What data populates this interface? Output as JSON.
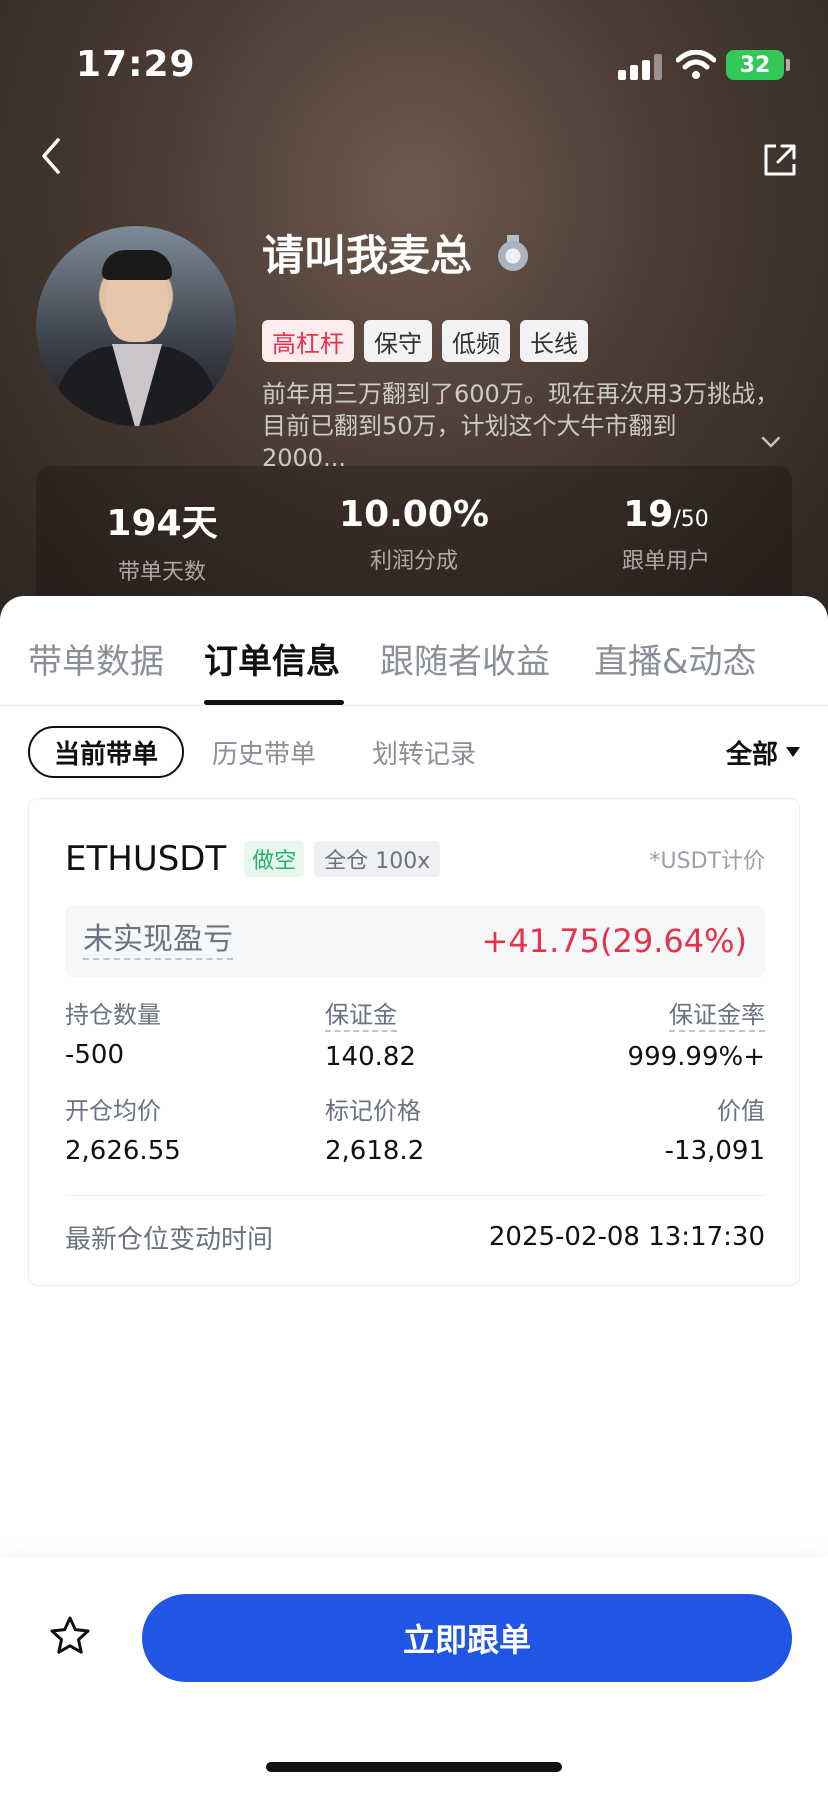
{
  "status_bar": {
    "time": "17:29",
    "battery": "32"
  },
  "profile": {
    "name": "请叫我麦总",
    "tags": [
      "高杠杆",
      "保守",
      "低频",
      "长线"
    ],
    "bio_line1": "前年用三万翻到了600万。现在再次用3万挑战，",
    "bio_line2": "目前已翻到50万，计划这个大牛市翻到2000..."
  },
  "stats": [
    {
      "value": "194天",
      "label": "带单天数"
    },
    {
      "value": "10.00%",
      "label": "利润分成"
    },
    {
      "value": "19",
      "value_suffix": "/50",
      "label": "跟单用户"
    }
  ],
  "tabs": [
    "带单数据",
    "订单信息",
    "跟随者收益",
    "直播&动态"
  ],
  "subtabs": [
    "当前带单",
    "历史带单",
    "划转记录"
  ],
  "filter": "全部",
  "position": {
    "symbol": "ETHUSDT",
    "side": "做空",
    "mode": "全仓 100x",
    "unit_note": "*USDT计价",
    "pnl_label": "未实现盈亏",
    "pnl_value": "+41.75(29.64%)",
    "fields": {
      "qty_label": "持仓数量",
      "qty_value": "-500",
      "margin_label": "保证金",
      "margin_value": "140.82",
      "margin_rate_label": "保证金率",
      "margin_rate_value": "999.99%+",
      "entry_label": "开仓均价",
      "entry_value": "2,626.55",
      "mark_label": "标记价格",
      "mark_value": "2,618.2",
      "value_label": "价值",
      "value_value": "-13,091"
    },
    "time_label": "最新仓位变动时间",
    "time_value": "2025-02-08 13:17:30"
  },
  "bottom": {
    "follow_label": "立即跟单"
  },
  "colors": {
    "accent": "#2155e3",
    "loss_red": "#e6324b",
    "short_green": "#24b36b"
  }
}
